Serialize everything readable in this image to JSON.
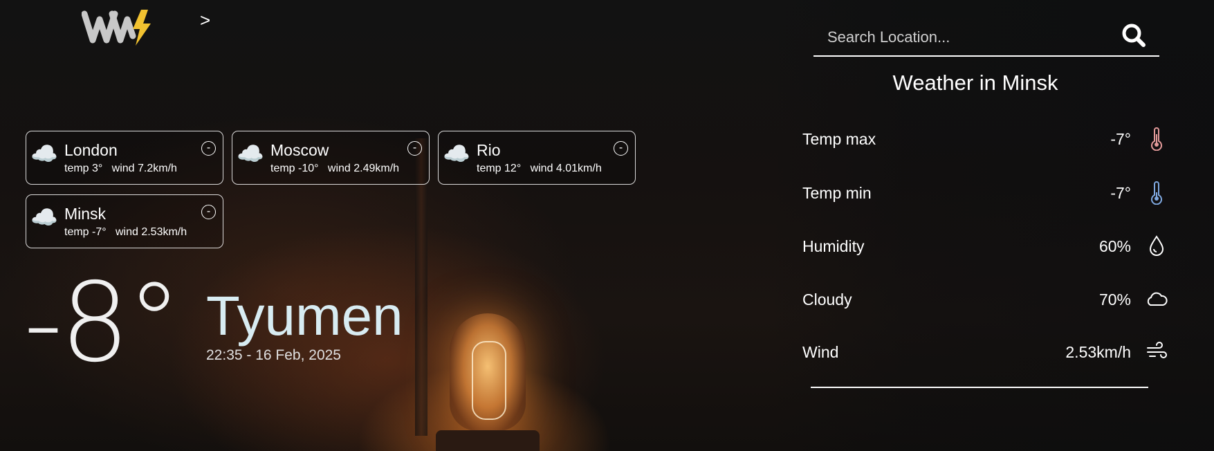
{
  "nav": {
    "arrow": ">"
  },
  "cities": [
    {
      "name": "London",
      "temp": "temp 3°",
      "wind": "wind 7.2km/h",
      "remove": "-"
    },
    {
      "name": "Moscow",
      "temp": "temp -10°",
      "wind": "wind 2.49km/h",
      "remove": "-"
    },
    {
      "name": "Rio",
      "temp": "temp 12°",
      "wind": "wind 4.01km/h",
      "remove": "-"
    },
    {
      "name": "Minsk",
      "temp": "temp -7°",
      "wind": "wind 2.53km/h",
      "remove": "-"
    }
  ],
  "current": {
    "temperature": "-8°",
    "city": "Tyumen",
    "datetime": "22:35 - 16 Feb, 2025"
  },
  "search": {
    "placeholder": "Search Location...",
    "icon": "search-icon"
  },
  "panel": {
    "title": "Weather in Minsk",
    "stats": [
      {
        "label": "Temp max",
        "value": "-7°",
        "icon": "thermometer-hot-icon"
      },
      {
        "label": "Temp min",
        "value": "-7°",
        "icon": "thermometer-cold-icon"
      },
      {
        "label": "Humidity",
        "value": "60%",
        "icon": "droplet-icon"
      },
      {
        "label": "Cloudy",
        "value": "70%",
        "icon": "cloud-icon"
      },
      {
        "label": "Wind",
        "value": "2.53km/h",
        "icon": "wind-icon"
      }
    ]
  },
  "colors": {
    "hot": "#e39a9a",
    "cold": "#7fa8e0",
    "text": "#ffffff",
    "city_tint": "#d8ecf2"
  }
}
